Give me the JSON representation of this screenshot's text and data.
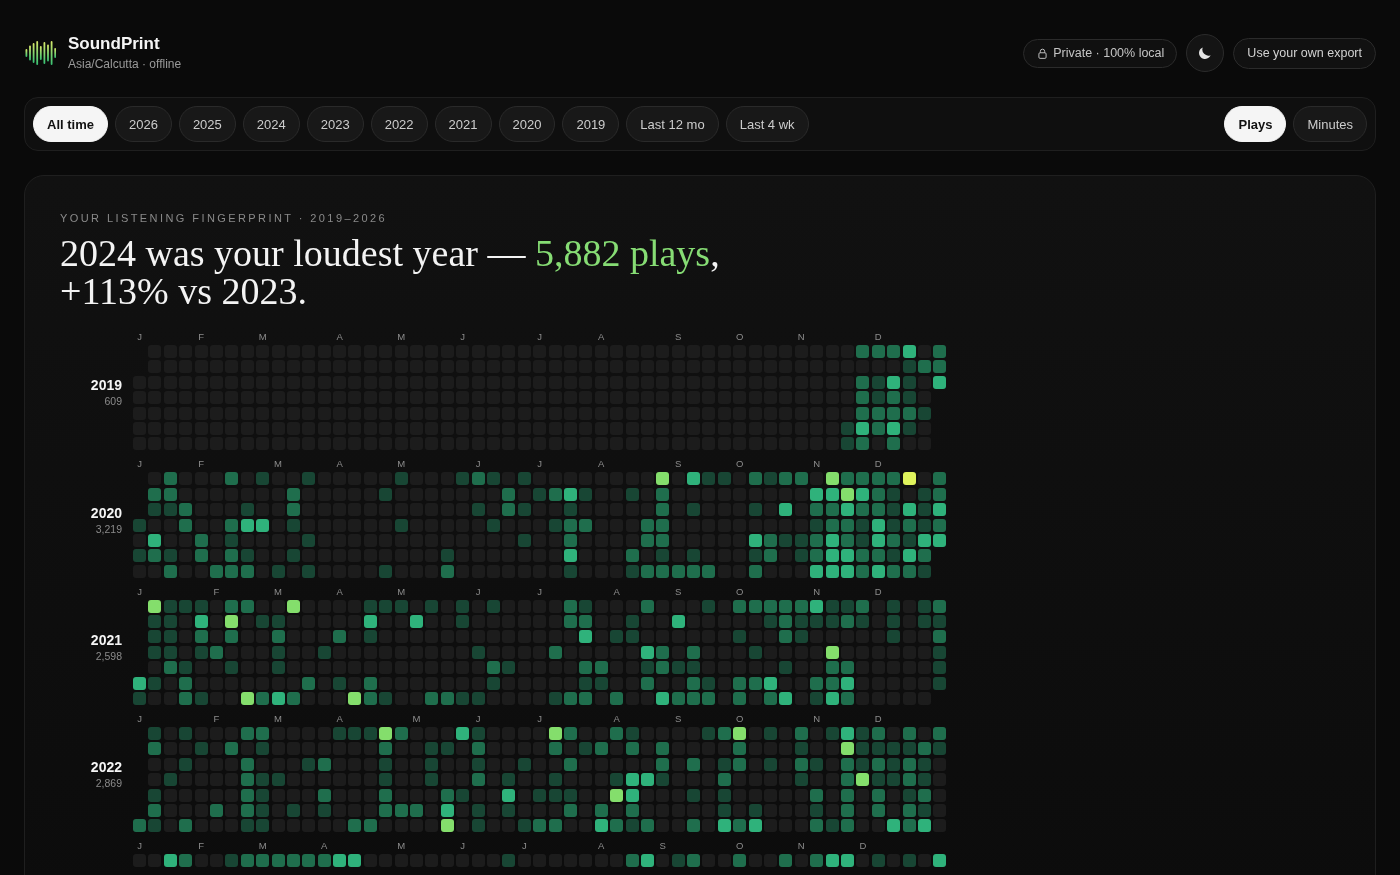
{
  "header": {
    "app_name": "SoundPrint",
    "subtitle": "Asia/Calcutta · offline",
    "privacy_badge": "Private · 100% local",
    "export_button": "Use your own export"
  },
  "range_tabs": [
    {
      "label": "All time",
      "selected": true
    },
    {
      "label": "2026",
      "selected": false
    },
    {
      "label": "2025",
      "selected": false
    },
    {
      "label": "2024",
      "selected": false
    },
    {
      "label": "2023",
      "selected": false
    },
    {
      "label": "2022",
      "selected": false
    },
    {
      "label": "2021",
      "selected": false
    },
    {
      "label": "2020",
      "selected": false
    },
    {
      "label": "2019",
      "selected": false
    },
    {
      "label": "Last 12 mo",
      "selected": false
    },
    {
      "label": "Last 4 wk",
      "selected": false
    }
  ],
  "metric_tabs": [
    {
      "label": "Plays",
      "selected": true
    },
    {
      "label": "Minutes",
      "selected": false
    }
  ],
  "fingerprint": {
    "eyebrow": "YOUR LISTENING FINGERPRINT · 2019–2026",
    "headline": {
      "lead": "2024 was your loudest year — ",
      "highlight": "5,882 plays",
      "tail": ", +113% vs 2023."
    },
    "years": [
      {
        "year": "2019",
        "total": "609",
        "months": [
          "J",
          "F",
          "M",
          "A",
          "M",
          "J",
          "J",
          "A",
          "S",
          "O",
          "N",
          "D"
        ]
      },
      {
        "year": "2020",
        "total": "3,219",
        "months": [
          "J",
          "F",
          "M",
          "A",
          "M",
          "J",
          "J",
          "A",
          "S",
          "O",
          "N",
          "D"
        ]
      },
      {
        "year": "2021",
        "total": "2,598",
        "months": [
          "J",
          "F",
          "M",
          "A",
          "M",
          "J",
          "J",
          "A",
          "S",
          "O",
          "N",
          "D"
        ]
      },
      {
        "year": "2022",
        "total": "2,869",
        "months": [
          "J",
          "F",
          "M",
          "A",
          "M",
          "J",
          "J",
          "A",
          "S",
          "O",
          "N",
          "D"
        ]
      },
      {
        "months": [
          "J",
          "F",
          "M",
          "A",
          "M",
          "J",
          "J",
          "A",
          "S",
          "O",
          "N",
          "D"
        ]
      }
    ]
  }
}
